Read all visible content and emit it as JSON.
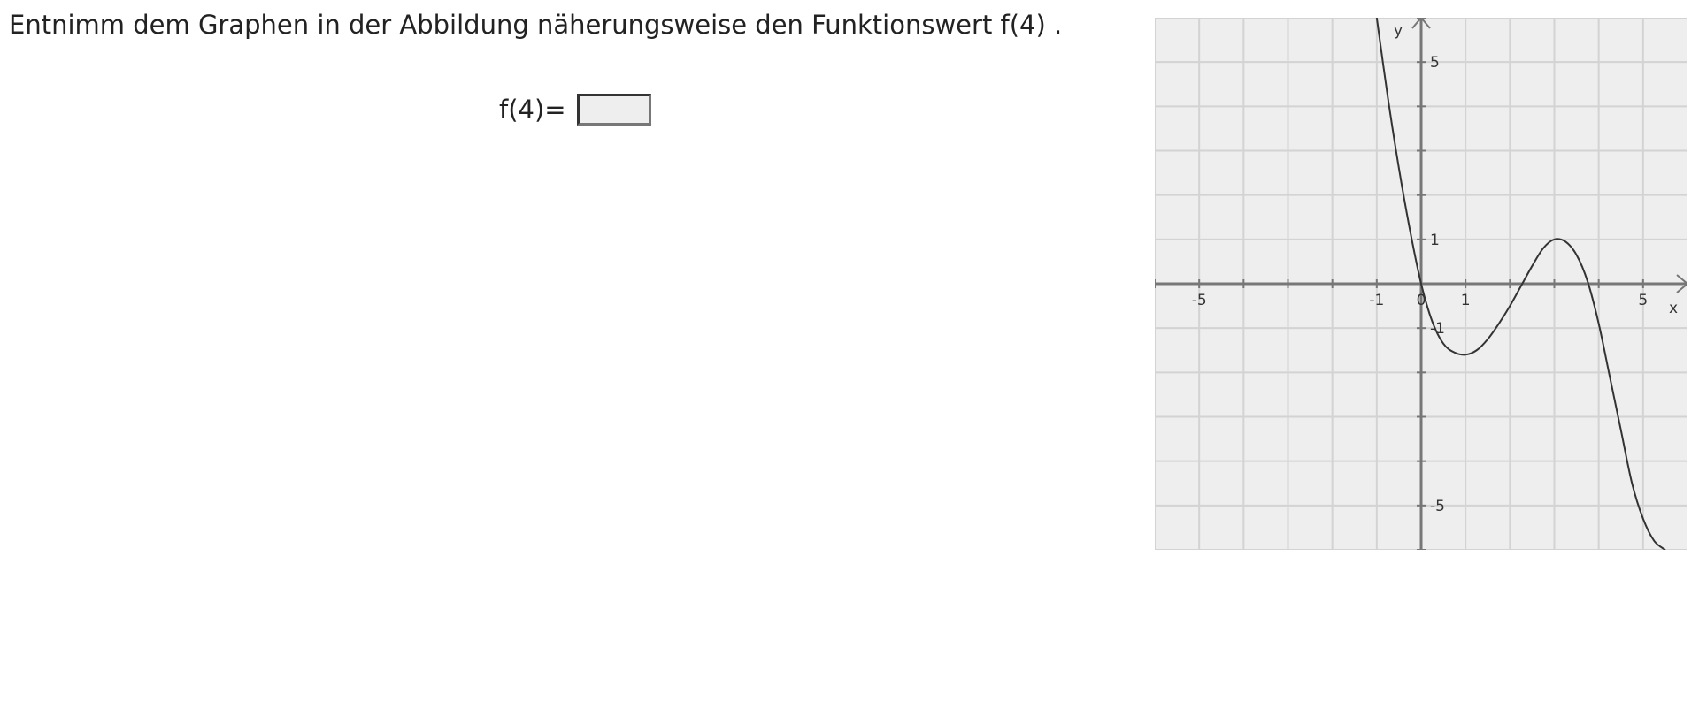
{
  "question": {
    "text": "Entnimm dem Graphen in der Abbildung näherungsweise den Funktionswert f(4) ."
  },
  "answer": {
    "label": "f(4)=",
    "value": ""
  },
  "chart_data": {
    "type": "line",
    "title": "",
    "xlabel": "x",
    "ylabel": "y",
    "xlim": [
      -6,
      6
    ],
    "ylim": [
      -6,
      6
    ],
    "grid": true,
    "background": "#eeeeee",
    "grid_color": "#d3d3d3",
    "axis_color": "#777777",
    "curve_color": "#333333",
    "x_tick_labels": [
      {
        "value": -5,
        "label": "-5"
      },
      {
        "value": -1,
        "label": "-1"
      },
      {
        "value": 0,
        "label": "0"
      },
      {
        "value": 1,
        "label": "1"
      },
      {
        "value": 5,
        "label": "5"
      }
    ],
    "y_tick_labels": [
      {
        "value": 5,
        "label": "5"
      },
      {
        "value": 1,
        "label": "1"
      },
      {
        "value": -1,
        "label": "-1"
      },
      {
        "value": -5,
        "label": "-5"
      }
    ],
    "series": [
      {
        "x": [
          -1.0,
          -0.75,
          -0.5,
          -0.25,
          0.0,
          0.25,
          0.5,
          0.75,
          1.0,
          1.25,
          1.5,
          1.75,
          2.0,
          2.25,
          2.5,
          2.75,
          3.0,
          3.25,
          3.5,
          3.75,
          4.0,
          4.25,
          4.5,
          4.75,
          5.0,
          5.25,
          5.5
        ],
        "y": [
          6.0,
          4.2,
          2.6,
          1.2,
          0.0,
          -0.85,
          -1.35,
          -1.55,
          -1.6,
          -1.5,
          -1.25,
          -0.9,
          -0.5,
          -0.05,
          0.4,
          0.8,
          1.0,
          0.95,
          0.65,
          0.05,
          -0.9,
          -2.1,
          -3.3,
          -4.5,
          -5.3,
          -5.8,
          -6.0
        ]
      }
    ]
  }
}
